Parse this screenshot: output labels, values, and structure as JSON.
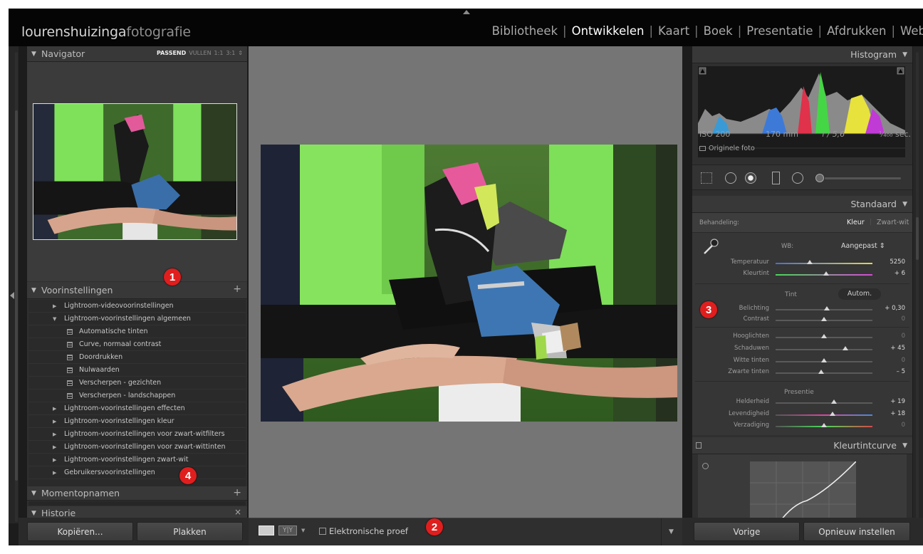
{
  "app": {
    "brand_part1": "lourenshuizinga",
    "brand_part2": "fotografie",
    "modules": [
      "Bibliotheek",
      "Ontwikkelen",
      "Kaart",
      "Boek",
      "Presentatie",
      "Afdrukken",
      "Web"
    ],
    "active_module": "Ontwikkelen"
  },
  "navigator": {
    "title": "Navigator",
    "zoom_options": [
      "PASSEND",
      "VULLEN",
      "1:1",
      "3:1"
    ],
    "zoom_current": "PASSEND"
  },
  "presets": {
    "title": "Voorinstellingen",
    "items": [
      {
        "label": "Lightroom-videovoorinstellingen",
        "type": "folder",
        "expanded": false
      },
      {
        "label": "Lightroom-voorinstellingen algemeen",
        "type": "folder",
        "expanded": true
      },
      {
        "label": "Automatische tinten",
        "type": "preset"
      },
      {
        "label": "Curve, normaal contrast",
        "type": "preset"
      },
      {
        "label": "Doordrukken",
        "type": "preset"
      },
      {
        "label": "Nulwaarden",
        "type": "preset"
      },
      {
        "label": "Verscherpen - gezichten",
        "type": "preset"
      },
      {
        "label": "Verscherpen - landschappen",
        "type": "preset"
      },
      {
        "label": "Lightroom-voorinstellingen effecten",
        "type": "folder",
        "expanded": false
      },
      {
        "label": "Lightroom-voorinstellingen kleur",
        "type": "folder",
        "expanded": false
      },
      {
        "label": "Lightroom-voorinstellingen voor zwart-witfilters",
        "type": "folder",
        "expanded": false
      },
      {
        "label": "Lightroom-voorinstellingen voor zwart-wittinten",
        "type": "folder",
        "expanded": false
      },
      {
        "label": "Lightroom-voorinstellingen zwart-wit",
        "type": "folder",
        "expanded": false
      },
      {
        "label": "Gebruikersvoorinstellingen",
        "type": "folder",
        "expanded": false
      }
    ]
  },
  "snapshots": {
    "title": "Momentopnamen"
  },
  "history": {
    "title": "Historie"
  },
  "left_buttons": {
    "copy": "Kopiëren...",
    "paste": "Plakken"
  },
  "toolbar": {
    "soft_proof": "Elektronische proef"
  },
  "histogram": {
    "title": "Histogram",
    "iso": "ISO 200",
    "focal": "170 mm",
    "aperture": "f / 5,6",
    "shutter": "¹⁄₄₀₀ sec.",
    "original_photo": "Originele foto"
  },
  "basic": {
    "title": "Standaard",
    "treatment_label": "Behandeling:",
    "treatment_color": "Kleur",
    "treatment_bw": "Zwart-wit",
    "wb_label": "WB:",
    "wb_value": "Aangepast",
    "tone_label": "Tint",
    "auto_label": "Autom.",
    "presence_label": "Presentie",
    "sliders": [
      {
        "label": "Temperatuur",
        "value": "5250",
        "pos": 0.35,
        "group": "wb"
      },
      {
        "label": "Kleurtint",
        "value": "+ 6",
        "pos": 0.52,
        "group": "wb"
      },
      {
        "label": "Belichting",
        "value": "+ 0,30",
        "pos": 0.53,
        "group": "tone"
      },
      {
        "label": "Contrast",
        "value": "0",
        "pos": 0.5,
        "group": "tone"
      },
      {
        "label": "Hooglichten",
        "value": "0",
        "pos": 0.5,
        "group": "tone2"
      },
      {
        "label": "Schaduwen",
        "value": "+ 45",
        "pos": 0.72,
        "group": "tone2"
      },
      {
        "label": "Witte tinten",
        "value": "0",
        "pos": 0.5,
        "group": "tone2"
      },
      {
        "label": "Zwarte tinten",
        "value": "– 5",
        "pos": 0.47,
        "group": "tone2"
      },
      {
        "label": "Helderheid",
        "value": "+ 19",
        "pos": 0.6,
        "group": "presence"
      },
      {
        "label": "Levendigheid",
        "value": "+ 18",
        "pos": 0.59,
        "group": "presence"
      },
      {
        "label": "Verzadiging",
        "value": "0",
        "pos": 0.5,
        "group": "presence"
      }
    ]
  },
  "tone_curve": {
    "title": "Kleurtintcurve"
  },
  "right_buttons": {
    "previous": "Vorige",
    "reset": "Opnieuw instellen"
  },
  "badges": [
    "1",
    "2",
    "3",
    "4"
  ]
}
